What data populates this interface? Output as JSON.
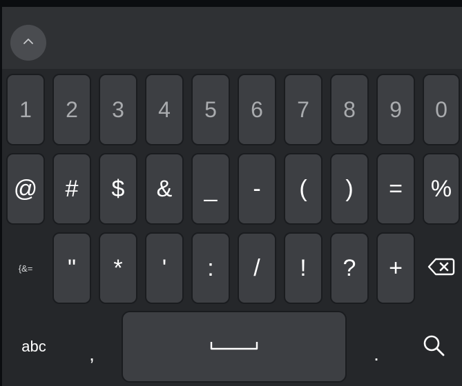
{
  "keyboard": {
    "number_row": [
      "1",
      "2",
      "3",
      "4",
      "5",
      "6",
      "7",
      "8",
      "9",
      "0"
    ],
    "symbol_row_1": [
      "@",
      "#",
      "$",
      "&",
      "_",
      "-",
      "(",
      ")",
      "=",
      "%"
    ],
    "more_symbols_label": "{&=",
    "symbol_row_2": [
      "\"",
      "*",
      "'",
      ":",
      "/",
      "!",
      "?",
      "+"
    ],
    "abc_label": "abc",
    "comma": ",",
    "period": "."
  },
  "icons": {
    "collapse": "chevron-up-icon",
    "backspace": "backspace-icon",
    "space": "space-bar-icon",
    "search": "search-icon"
  },
  "colors": {
    "toolbar": "#2f3134",
    "keyboard_bg": "#25272a",
    "key": "#3d3f43",
    "digit_text": "#a9abae",
    "symbol_text": "#ffffff"
  }
}
